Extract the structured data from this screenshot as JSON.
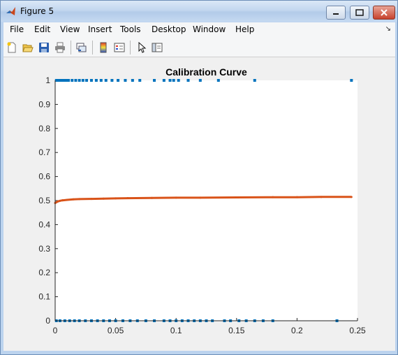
{
  "window": {
    "title": "Figure 5"
  },
  "menu": {
    "items": [
      "File",
      "Edit",
      "View",
      "Insert",
      "Tools",
      "Desktop",
      "Window",
      "Help"
    ]
  },
  "toolbar": {
    "icons": [
      "new-figure-icon",
      "open-file-icon",
      "save-icon",
      "print-icon",
      "link-icon",
      "colorbar-icon",
      "legend-icon",
      "pointer-icon",
      "property-editor-icon"
    ]
  },
  "colors": {
    "outcomes": "#0072BD",
    "calibration": "#D95319",
    "axes_background": "#ffffff",
    "figure_background": "#f0f0f0"
  },
  "chart_data": {
    "type": "scatter",
    "title": "Calibration Curve",
    "xlabel": "",
    "ylabel": "",
    "xlim": [
      0,
      0.25
    ],
    "ylim": [
      0,
      1
    ],
    "x_ticks": [
      "0",
      "0.05",
      "0.1",
      "0.15",
      "0.2",
      "0.25"
    ],
    "y_ticks": [
      "0",
      "0.1",
      "0.2",
      "0.3",
      "0.4",
      "0.5",
      "0.6",
      "0.7",
      "0.8",
      "0.9",
      "1"
    ],
    "grid": false,
    "series": [
      {
        "kind": "scatter",
        "x": [
          0.001,
          0.003,
          0.005,
          0.007,
          0.009,
          0.011,
          0.014,
          0.017,
          0.02,
          0.023,
          0.026,
          0.03,
          0.034,
          0.038,
          0.042,
          0.047,
          0.052,
          0.058,
          0.064,
          0.07,
          0.082,
          0.09,
          0.095,
          0.098,
          0.102,
          0.11,
          0.12,
          0.135,
          0.165,
          0.245,
          0.001,
          0.004,
          0.008,
          0.012,
          0.016,
          0.02,
          0.025,
          0.03,
          0.035,
          0.04,
          0.045,
          0.05,
          0.056,
          0.062,
          0.068,
          0.075,
          0.082,
          0.09,
          0.095,
          0.1,
          0.105,
          0.11,
          0.115,
          0.12,
          0.125,
          0.13,
          0.14,
          0.145,
          0.152,
          0.158,
          0.165,
          0.172,
          0.18,
          0.233
        ],
        "y": [
          1,
          1,
          1,
          1,
          1,
          1,
          1,
          1,
          1,
          1,
          1,
          1,
          1,
          1,
          1,
          1,
          1,
          1,
          1,
          1,
          1,
          1,
          1,
          1,
          1,
          1,
          1,
          1,
          1,
          1,
          0,
          0,
          0,
          0,
          0,
          0,
          0,
          0,
          0,
          0,
          0,
          0,
          0,
          0,
          0,
          0,
          0,
          0,
          0,
          0,
          0,
          0,
          0,
          0,
          0,
          0,
          0,
          0,
          0,
          0,
          0,
          0,
          0,
          0
        ]
      },
      {
        "kind": "line",
        "x": [
          0,
          0.001,
          0.002,
          0.004,
          0.006,
          0.01,
          0.015,
          0.02,
          0.03,
          0.04,
          0.05,
          0.06,
          0.08,
          0.1,
          0.12,
          0.15,
          0.18,
          0.2,
          0.22,
          0.245
        ],
        "y": [
          0.49,
          0.493,
          0.496,
          0.499,
          0.501,
          0.503,
          0.505,
          0.506,
          0.507,
          0.508,
          0.509,
          0.51,
          0.511,
          0.512,
          0.512,
          0.513,
          0.514,
          0.514,
          0.515,
          0.515
        ]
      }
    ]
  }
}
